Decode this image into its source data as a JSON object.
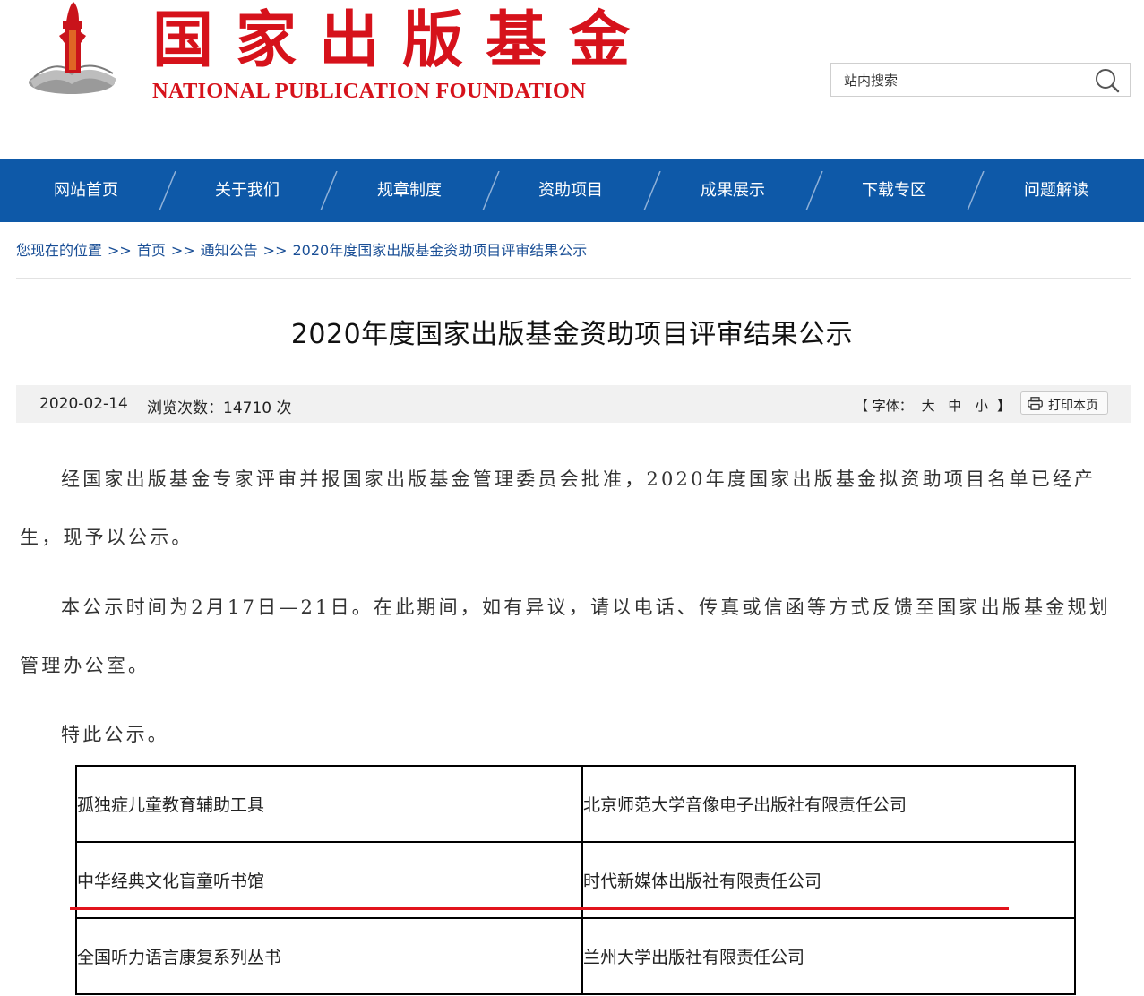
{
  "header": {
    "title_cn": "国家出版基金",
    "title_en": "NATIONAL PUBLICATION FOUNDATION",
    "search_placeholder": "站内搜索"
  },
  "nav": {
    "items": [
      {
        "label": "网站首页"
      },
      {
        "label": "关于我们"
      },
      {
        "label": "规章制度"
      },
      {
        "label": "资助项目"
      },
      {
        "label": "成果展示"
      },
      {
        "label": "下载专区"
      },
      {
        "label": "问题解读"
      }
    ]
  },
  "breadcrumb": {
    "prefix": "您现在的位置",
    "sep": ">>",
    "items": [
      "首页",
      "通知公告",
      "2020年度国家出版基金资助项目评审结果公示"
    ]
  },
  "article": {
    "title": "2020年度国家出版基金资助项目评审结果公示",
    "date": "2020-02-14",
    "views": "浏览次数：14710 次",
    "font_size_label": "【 字体：",
    "font_size_options": [
      "大",
      "中",
      "小"
    ],
    "font_size_end": "】",
    "print_label": "打印本页",
    "paragraphs": [
      "经国家出版基金专家评审并报国家出版基金管理委员会批准，2020年度国家出版基金拟资助项目名单已经产生，现予以公示。",
      "本公示时间为2月17日—21日。在此期间，如有异议，请以电话、传真或信函等方式反馈至国家出版基金规划管理办公室。",
      "特此公示。"
    ]
  },
  "table": {
    "rows": [
      [
        "孤独症儿童教育辅助工具",
        "北京师范大学音像电子出版社有限责任公司"
      ],
      [
        "中华经典文化盲童听书馆",
        "时代新媒体出版社有限责任公司"
      ],
      [
        "全国听力语言康复系列丛书",
        "兰州大学出版社有限责任公司"
      ]
    ]
  },
  "colors": {
    "brand_red": "#d6121b",
    "nav_blue": "#0e59a8",
    "link_blue": "#1a4f96",
    "highlight_underline": "#e2141c"
  }
}
